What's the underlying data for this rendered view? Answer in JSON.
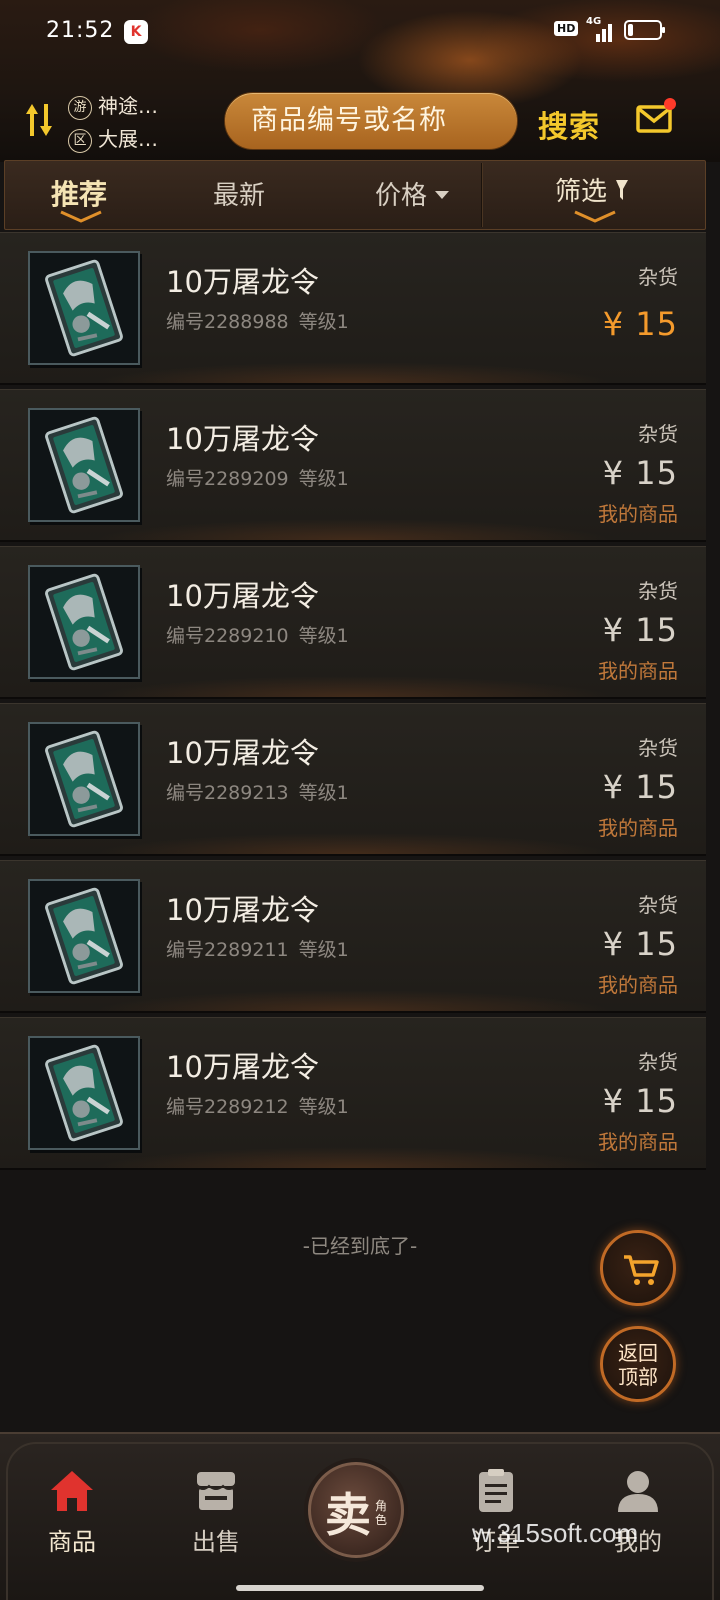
{
  "status_bar": {
    "time": "21:52",
    "hd": "HD",
    "network": "4G"
  },
  "header": {
    "game_badge": "游",
    "game_name": "神途…",
    "zone_badge": "区",
    "zone_name": "大展…",
    "search_placeholder": "商品编号或名称",
    "search_button": "搜索",
    "icons": [
      "switch-arrows-icon",
      "mail-icon"
    ]
  },
  "tabs": [
    {
      "label": "推荐",
      "active": true
    },
    {
      "label": "最新",
      "active": false
    },
    {
      "label": "价格",
      "active": false
    },
    {
      "label": "筛选",
      "active": false
    }
  ],
  "products": [
    {
      "name": "10万屠龙令",
      "id_text": "编号2288988",
      "level_text": "等级1",
      "category": "杂货",
      "price": "¥ 15",
      "mine": ""
    },
    {
      "name": "10万屠龙令",
      "id_text": "编号2289209",
      "level_text": "等级1",
      "category": "杂货",
      "price": "¥ 15",
      "mine": "我的商品"
    },
    {
      "name": "10万屠龙令",
      "id_text": "编号2289210",
      "level_text": "等级1",
      "category": "杂货",
      "price": "¥ 15",
      "mine": "我的商品"
    },
    {
      "name": "10万屠龙令",
      "id_text": "编号2289213",
      "level_text": "等级1",
      "category": "杂货",
      "price": "¥ 15",
      "mine": "我的商品"
    },
    {
      "name": "10万屠龙令",
      "id_text": "编号2289211",
      "level_text": "等级1",
      "category": "杂货",
      "price": "¥ 15",
      "mine": "我的商品"
    },
    {
      "name": "10万屠龙令",
      "id_text": "编号2289212",
      "level_text": "等级1",
      "category": "杂货",
      "price": "¥ 15",
      "mine": "我的商品"
    }
  ],
  "list_end_text": "-已经到底了-",
  "floating": {
    "cart_icon": "cart-icon",
    "back_to_top": "返回顶部"
  },
  "bottom_nav": {
    "goods": "商品",
    "sell": "出售",
    "sell_role_big": "卖",
    "sell_role_small": "角色",
    "orders": "订单",
    "mine": "我的"
  },
  "watermark": "w.315soft.com",
  "colors": {
    "accent_orange": "#f49a2c",
    "search_gold": "#f4c82c",
    "mine_label": "#c0783a",
    "home_red": "#e0332e"
  }
}
